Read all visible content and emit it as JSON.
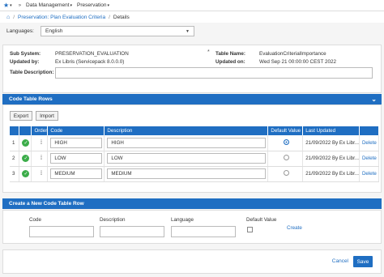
{
  "topbar": {
    "data_management": "Data Management",
    "preservation": "Preservation"
  },
  "breadcrumb": {
    "item1": "Preservation: Plan Evaluation Criteria",
    "item2": "Details"
  },
  "language": {
    "label": "Languages:",
    "value": "English"
  },
  "info": {
    "sub_system_label": "Sub System:",
    "sub_system_value": "PRESERVATION_EVALUATION",
    "updated_by_label": "Updated by:",
    "updated_by_value": "Ex Libris (Servicepack 8.0.0.0)",
    "table_name_label": "Table Name:",
    "table_name_value": "EvaluationCriterialImportance",
    "updated_on_label": "Updated on:",
    "updated_on_value": "Wed Sep 21 00:00:00 CEST 2022",
    "table_description_label": "Table Description:",
    "asterisk": "*"
  },
  "rows_section": {
    "title": "Code Table Rows",
    "export": "Export",
    "import": "Import",
    "columns": [
      "",
      "Order",
      "Code",
      "Description",
      "Default Value",
      "Last Updated",
      ""
    ],
    "rows": [
      {
        "num": "1",
        "code": "HIGH",
        "description": "HIGH",
        "default": true,
        "updated": "21/09/2022",
        "by": "By Ex Libr...",
        "action": "Delete"
      },
      {
        "num": "2",
        "code": "LOW",
        "description": "LOW",
        "default": false,
        "updated": "21/09/2022",
        "by": "By Ex Libr...",
        "action": "Delete"
      },
      {
        "num": "3",
        "code": "MEDIUM",
        "description": "MEDIUM",
        "default": false,
        "updated": "21/09/2022",
        "by": "By Ex Libr...",
        "action": "Delete"
      }
    ]
  },
  "create_section": {
    "title": "Create a New Code Table Row",
    "code_label": "Code",
    "description_label": "Description",
    "language_label": "Language",
    "default_label": "Default Value",
    "create": "Create"
  },
  "footer": {
    "cancel": "Cancel",
    "save": "Save"
  },
  "colors": {
    "accent": "#1f6ec2",
    "success": "#3cad4a"
  }
}
